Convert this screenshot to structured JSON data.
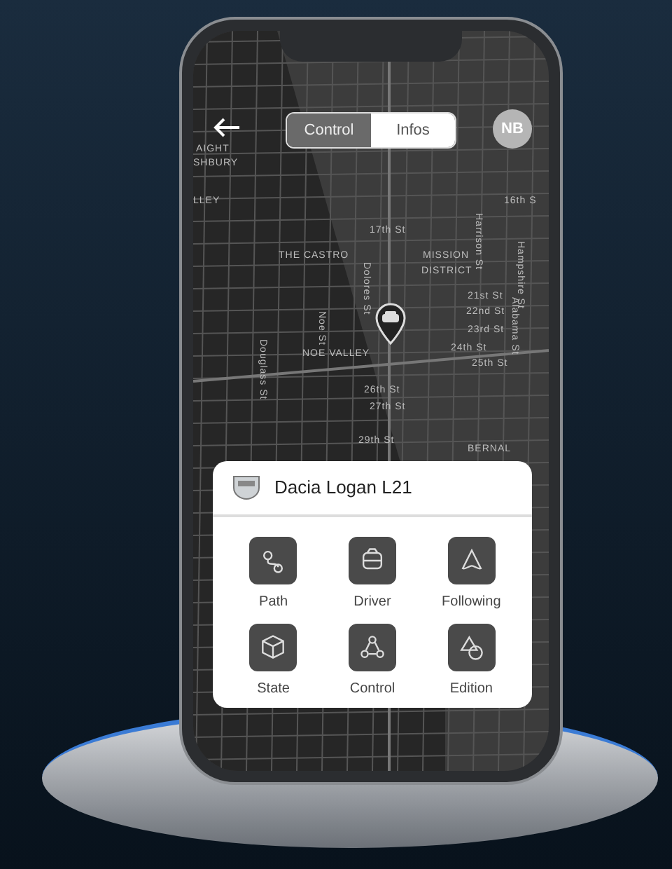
{
  "header": {
    "tabs": [
      {
        "label": "Control",
        "selected": false
      },
      {
        "label": "Infos",
        "selected": true
      }
    ],
    "avatar": "NB"
  },
  "map_labels": [
    "AIGHT",
    "SHBURY",
    "LLEY",
    "16th S",
    "Harrison St",
    "17th St",
    "THE CASTRO",
    "MISSION",
    "DISTRICT",
    "Hampshire St",
    "Dolores St",
    "21st St",
    "22nd St",
    "23rd St",
    "24th St",
    "25th St",
    "Alabama St",
    "Noe St",
    "Douglass St",
    "NOE VALLEY",
    "26th St",
    "27th St",
    "29th St",
    "BERNAL"
  ],
  "card": {
    "title": "Dacia Logan L21",
    "actions": [
      {
        "kind": "path",
        "label": "Path"
      },
      {
        "kind": "driver",
        "label": "Driver"
      },
      {
        "kind": "following",
        "label": "Following"
      },
      {
        "kind": "state",
        "label": "State"
      },
      {
        "kind": "control",
        "label": "Control"
      },
      {
        "kind": "edition",
        "label": "Edition"
      }
    ]
  }
}
